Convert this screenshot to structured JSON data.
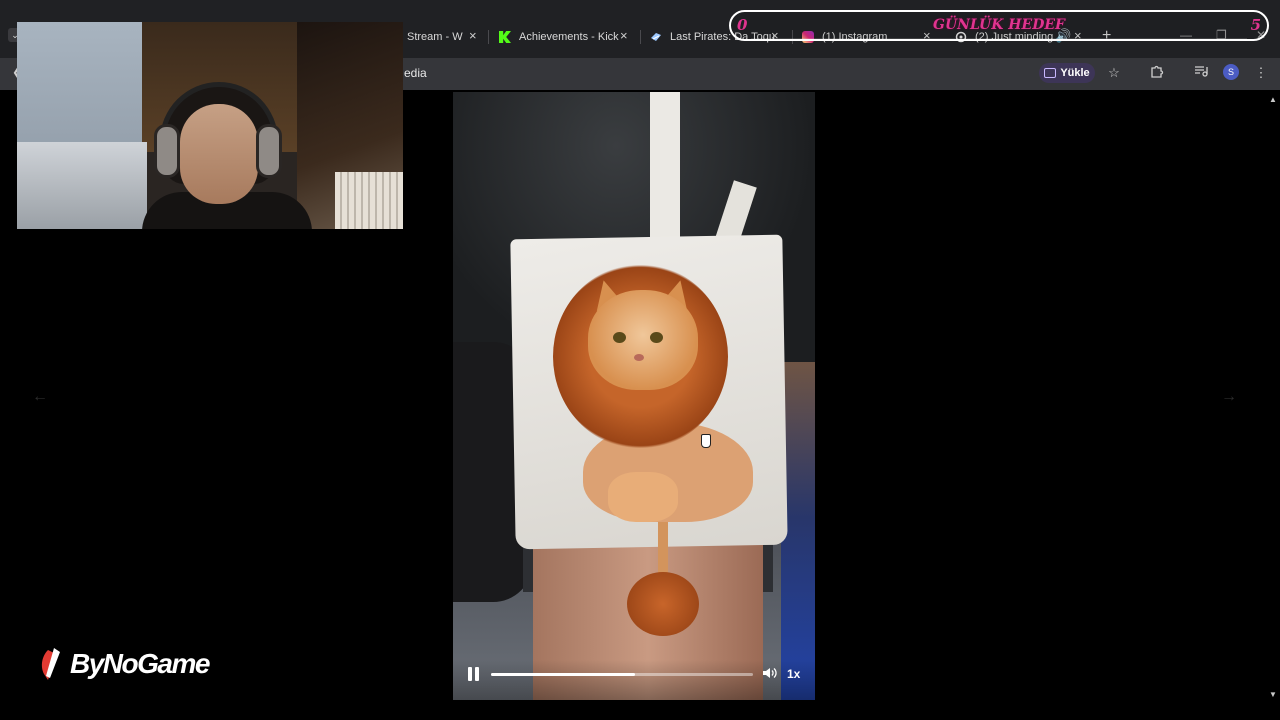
{
  "browser": {
    "tabs": [
      {
        "title": "Stream - W",
        "icon": "stream-favicon",
        "close": "×"
      },
      {
        "title": "Achievements - Kick",
        "icon": "kick-favicon",
        "close": "×"
      },
      {
        "title": "Last Pirates: Da Toqu",
        "icon": "game-favicon",
        "close": "×"
      },
      {
        "title": "(1) Instagram",
        "icon": "instagram-favicon",
        "close": "×"
      },
      {
        "title": "(2) Just minding",
        "icon": "threads-favicon",
        "close": "×"
      }
    ],
    "new_tab": "+",
    "url_fragment": "edia",
    "install_label": "Yükle",
    "profile_initial": "S",
    "colors": {
      "accent": "#3d3557",
      "avatar": "#4b5cc4",
      "kick_green": "#53fc18"
    }
  },
  "goal_overlay": {
    "title": "GÜNLÜK HEDEF",
    "current": "0",
    "target": "5",
    "progress_fraction": 0.0,
    "color": "#e0348f"
  },
  "video": {
    "playback_state": "playing",
    "progress_fraction": 0.55,
    "speed_label": "1x",
    "content_description_icon": "lion-cat-bag"
  },
  "navigation": {
    "prev_icon": "arrow-left-icon",
    "next_icon": "arrow-right-icon"
  },
  "brand": {
    "logo_text": "ByNoGame"
  }
}
